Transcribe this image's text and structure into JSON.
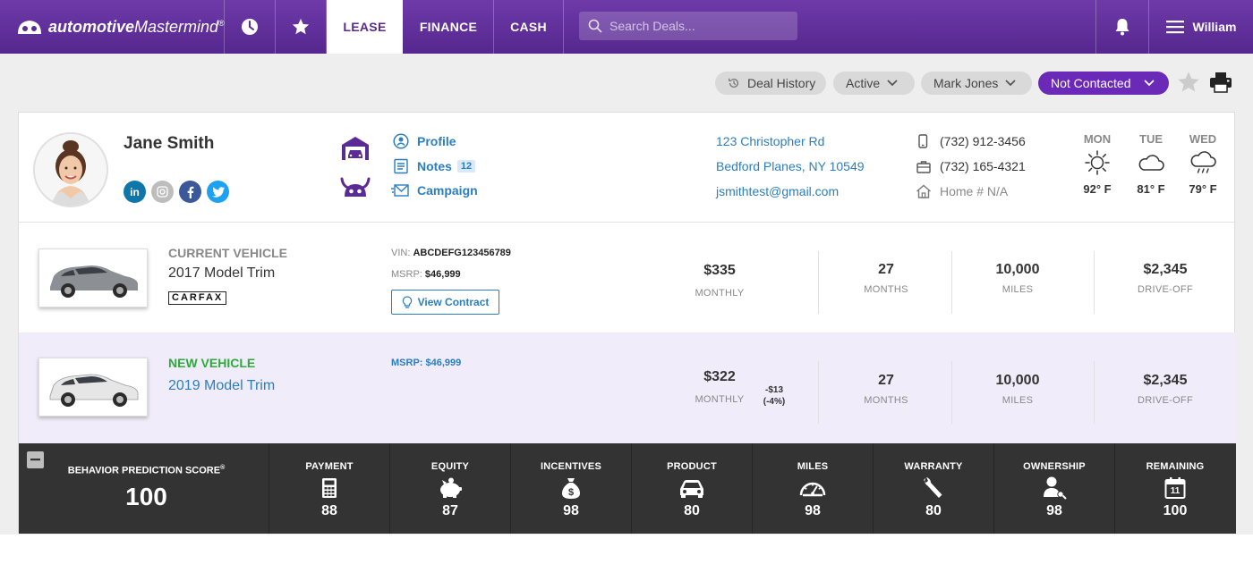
{
  "header": {
    "logo_bold": "automotive",
    "logo_light": "Mastermind",
    "logo_mark": "®",
    "tabs": [
      {
        "label": "LEASE",
        "active": true
      },
      {
        "label": "FINANCE",
        "active": false
      },
      {
        "label": "CASH",
        "active": false
      }
    ],
    "search_placeholder": "Search Deals...",
    "user_name": "William"
  },
  "toolbar": {
    "deal_history": "Deal History",
    "status": "Active",
    "salesperson": "Mark Jones",
    "contact_status": "Not Contacted"
  },
  "customer": {
    "name": "Jane Smith",
    "links": {
      "profile": "Profile",
      "notes": "Notes",
      "notes_count": "12",
      "campaign": "Campaign"
    },
    "address_line1": "123 Christopher Rd",
    "address_line2": "Bedford Planes, NY 10549",
    "email": "jsmithtest@gmail.com",
    "phone_mobile": "(732) 912-3456",
    "phone_work": "(732) 165-4321",
    "phone_home": "Home # N/A",
    "weather": [
      {
        "day": "MON",
        "temp": "92° F",
        "icon": "sun-icon"
      },
      {
        "day": "TUE",
        "temp": "81° F",
        "icon": "cloud-icon"
      },
      {
        "day": "WED",
        "temp": "79° F",
        "icon": "rain-cloud-icon"
      }
    ]
  },
  "current_vehicle": {
    "label": "CURRENT VEHICLE",
    "model": "2017 Model Trim",
    "carfax": "CARFAX",
    "vin_label": "VIN:",
    "vin": "ABCDEFG123456789",
    "msrp_label": "MSRP:",
    "msrp": "$46,999",
    "view_contract": "View Contract",
    "monthly": "$335",
    "monthly_label": "MONTHLY",
    "months": "27",
    "months_label": "MONTHS",
    "miles": "10,000",
    "miles_label": "MILES",
    "driveoff": "$2,345",
    "driveoff_label": "DRIVE-OFF"
  },
  "new_vehicle": {
    "label": "NEW VEHICLE",
    "model": "2019 Model Trim",
    "msrp_text": "MSRP: $46,999",
    "monthly": "$322",
    "monthly_label": "MONTHLY",
    "diff": "-$13",
    "diff_pct": "(-4%)",
    "months": "27",
    "months_label": "MONTHS",
    "miles": "10,000",
    "miles_label": "MILES",
    "driveoff": "$2,345",
    "driveoff_label": "DRIVE-OFF"
  },
  "bps": {
    "title": "BEHAVIOR PREDICTION SCORE",
    "title_mark": "®",
    "score": "100",
    "items": [
      {
        "label": "PAYMENT",
        "value": "88",
        "icon": "calculator-icon"
      },
      {
        "label": "EQUITY",
        "value": "87",
        "icon": "piggy-bank-icon"
      },
      {
        "label": "INCENTIVES",
        "value": "98",
        "icon": "money-bag-icon"
      },
      {
        "label": "PRODUCT",
        "value": "80",
        "icon": "car-icon"
      },
      {
        "label": "MILES",
        "value": "98",
        "icon": "speedometer-icon"
      },
      {
        "label": "WARRANTY",
        "value": "80",
        "icon": "wrench-icon"
      },
      {
        "label": "OWNERSHIP",
        "value": "98",
        "icon": "owner-key-icon"
      },
      {
        "label": "REMAINING",
        "value": "100",
        "icon": "calendar-icon",
        "calendar_day": "11"
      }
    ]
  },
  "colors": {
    "brand_purple": "#5b2b95",
    "accent_purple": "#6a2ab7",
    "link_blue": "#2b7ec1",
    "new_vehicle_green": "#2eaa3c",
    "bps_bg": "#333333"
  }
}
